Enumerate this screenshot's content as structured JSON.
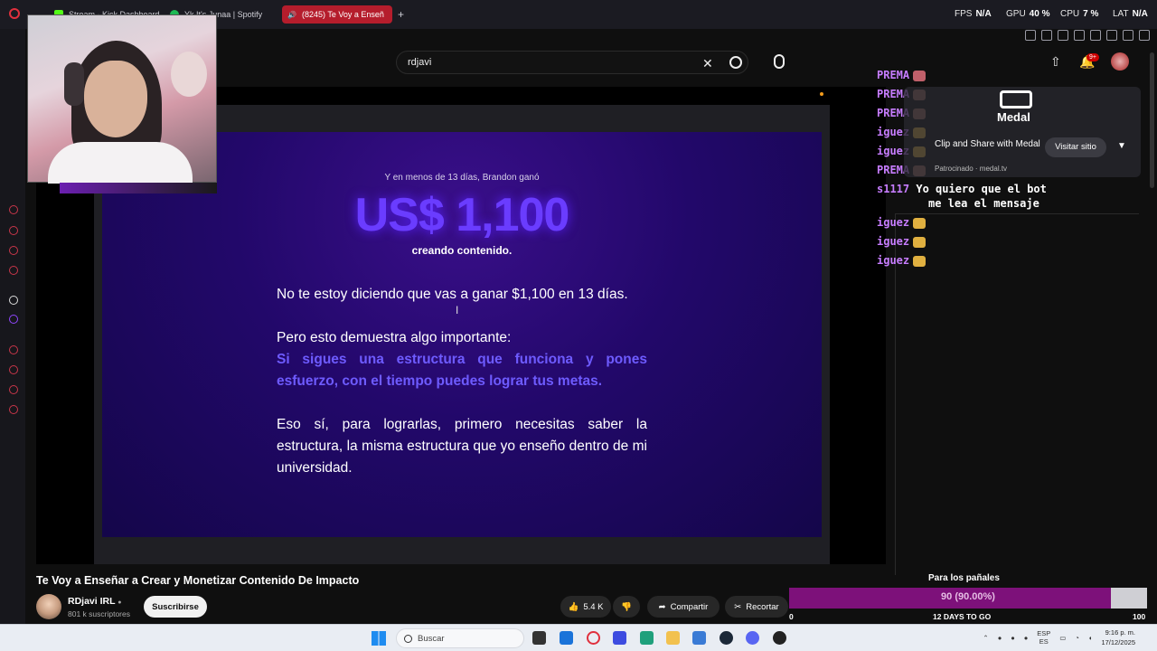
{
  "browser": {
    "tabs": [
      {
        "label": "Stream - Kick Dashboard",
        "color": "#53fc18"
      },
      {
        "label": "Yk It's Junaa | Spotify",
        "color": "#1db954"
      },
      {
        "label": "(8245) Te Voy a Enseñ",
        "color": "#ff0033",
        "active": true
      }
    ],
    "new_tab": "+",
    "hud": {
      "fps_label": "FPS",
      "fps": "N/A",
      "gpu_label": "GPU",
      "gpu": "40 %",
      "cpu_label": "CPU",
      "cpu": "7 %",
      "lat_label": "LAT",
      "lat": "N/A"
    }
  },
  "youtube": {
    "search": {
      "value": "rdjavi",
      "clear": "✕",
      "search_icon": "search-icon",
      "mic_icon": "mic-icon"
    },
    "upload_icon": "upload-icon",
    "notifications": {
      "badge": "9+"
    },
    "video": {
      "title": "Te Voy a Enseñar a Crear y Monetizar Contenido De Impacto",
      "channel": "RDjavi IRL",
      "verified": "●",
      "subscribers": "801 k suscriptores",
      "subscribe_label": "Suscribirse",
      "likes": "5.4 K",
      "share_label": "Compartir",
      "clip_label": "Recortar"
    },
    "slide": {
      "kicker": "Y en menos de 13 días, Brandon ganó",
      "amount": "US$ 1,100",
      "amount_sub": "creando contenido.",
      "para1": "No te estoy diciendo que vas a ganar $1,100 en 13 días.",
      "para2": "Pero esto demuestra algo importante:",
      "para2_highlight": "Si sigues una estructura que funciona y pones esfuerzo, con el tiempo puedes lograr tus metas.",
      "para3": "Eso sí, para lograrlas, primero necesitas saber la estructura, la misma estructura que yo enseño dentro de mi universidad."
    }
  },
  "chat": {
    "lines": [
      {
        "user": "PREMA",
        "msg": "",
        "emote": "#c0606a"
      },
      {
        "user": "PREMA",
        "msg": "",
        "emote": "#a07060"
      },
      {
        "user": "PREMA",
        "msg": "",
        "emote": "#a07060"
      },
      {
        "user": "iguez",
        "msg": "",
        "emote": "#e0b040"
      },
      {
        "user": "iguez",
        "msg": "",
        "emote": "#e0b040"
      },
      {
        "user": "PREMA",
        "msg": "",
        "emote": "#a07060"
      },
      {
        "user": "s1117",
        "msg": "Yo quiero que el bot",
        "emote": ""
      },
      {
        "user": "",
        "msg": "me lea el mensaje",
        "emote": ""
      },
      {
        "user": "iguez",
        "msg": "",
        "emote": "#e0b040"
      },
      {
        "user": "iguez",
        "msg": "",
        "emote": "#e0b040"
      },
      {
        "user": "iguez",
        "msg": "",
        "emote": "#e0b040"
      }
    ]
  },
  "medal": {
    "logo": "Medal",
    "title": "Clip and Share with Medal",
    "visit": "Visitar sitio",
    "sponsor": "Patrocinado · medal.tv"
  },
  "goal": {
    "label": "Para los pañales",
    "progress_text": "90 (90.00%)",
    "progress_fraction": 0.9,
    "days": "12 DAYS TO GO",
    "start": "0",
    "end": "100",
    "fill_color": "#7d117a"
  },
  "taskbar": {
    "search_placeholder": "Buscar",
    "lang": "ESP",
    "lang_sub": "ES",
    "time": "9:16 p. m.",
    "date": "17/12/2025"
  }
}
